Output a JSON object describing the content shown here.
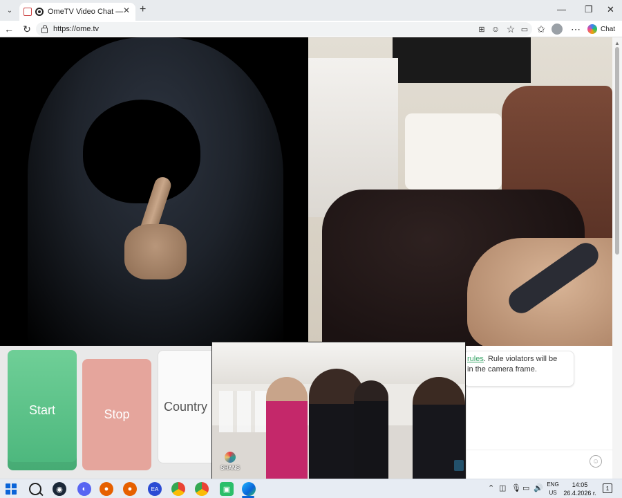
{
  "browser": {
    "tab_title": "OmeTV Video Chat — Omegle",
    "tab_close": "✕",
    "new_tab": "+",
    "url": "https://ome.tv",
    "chat_label": "Chat",
    "window_controls": {
      "minimize": "—",
      "restore": "❐",
      "close": "✕"
    }
  },
  "controls": {
    "start_label": "Start",
    "stop_label": "Stop",
    "country_label": "Country"
  },
  "chat": {
    "rules_link": "rules",
    "rules_text": ". Rule violators will be",
    "rules_text2": "in the camera frame.",
    "emoji_glyph": "☺"
  },
  "overlay": {
    "logo_text": "SHANS"
  },
  "taskbar": {
    "lang_top": "ENG",
    "lang_bottom": "US",
    "time": "14:05",
    "date": "26.4.2026 г.",
    "chevron": "⌃",
    "notification_glyph": "1"
  },
  "colors": {
    "start": "#5cc28a",
    "stop": "#e5a59c",
    "link": "#3aa568",
    "accent": "#0a64d8"
  },
  "icons": [
    "tab-menu-icon",
    "record-icon",
    "back-icon",
    "reload-icon",
    "lock-icon",
    "extensions-icon",
    "emoji-icon",
    "favorite-icon",
    "camera-icon",
    "collections-icon",
    "profile-icon",
    "more-icon",
    "copilot-icon",
    "windows-icon",
    "search-icon",
    "steam-icon",
    "discord-icon",
    "firefox-icon",
    "ea-icon",
    "chrome-icon",
    "android-icon",
    "edge-icon"
  ]
}
